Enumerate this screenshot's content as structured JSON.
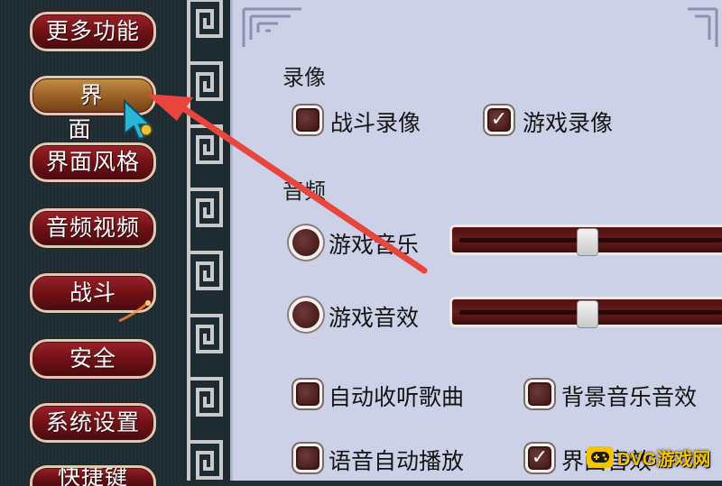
{
  "sidebar": {
    "items": [
      {
        "label": "更多功能"
      },
      {
        "label": "界面"
      },
      {
        "label": "界面风格"
      },
      {
        "label": "音频视频"
      },
      {
        "label": "战斗"
      },
      {
        "label": "安全"
      },
      {
        "label": "系统设置"
      },
      {
        "label": "快捷键"
      }
    ],
    "active_index": 1
  },
  "recording": {
    "title": "录像",
    "battle_recording": {
      "label": "战斗录像",
      "checked": false
    },
    "game_recording": {
      "label": "游戏录像",
      "checked": true
    }
  },
  "audio": {
    "title": "音频",
    "music": {
      "label": "游戏音乐",
      "level_percent": 50
    },
    "sfx": {
      "label": "游戏音效",
      "level_percent": 50
    },
    "auto_listen": {
      "label": "自动收听歌曲",
      "checked": false
    },
    "bg_music_sfx": {
      "label": "背景音乐音效",
      "checked": false
    },
    "voice_autoplay": {
      "label": "语音自动播放",
      "checked": false
    },
    "ui_sfx": {
      "label": "界面音效",
      "checked": true
    }
  },
  "watermark": {
    "text": "DVG游戏网"
  },
  "colors": {
    "panel_bg": "#ccd1e8",
    "button_red": "#741318",
    "button_active": "#9c6326",
    "arrow_red": "#e8453c"
  }
}
